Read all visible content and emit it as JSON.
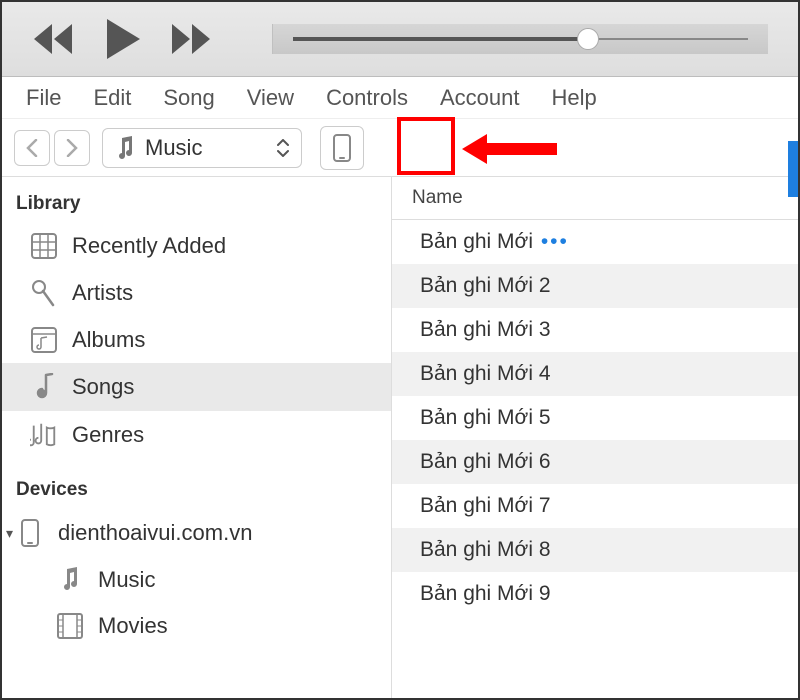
{
  "menubar": [
    "File",
    "Edit",
    "Song",
    "View",
    "Controls",
    "Account",
    "Help"
  ],
  "toolbar": {
    "source_label": "Music"
  },
  "library": {
    "title": "Library",
    "items": [
      {
        "label": "Recently Added",
        "icon": "grid"
      },
      {
        "label": "Artists",
        "icon": "mic"
      },
      {
        "label": "Albums",
        "icon": "album"
      },
      {
        "label": "Songs",
        "icon": "note",
        "selected": true
      },
      {
        "label": "Genres",
        "icon": "genres"
      }
    ]
  },
  "devices": {
    "title": "Devices",
    "device_name": "dienthoaivui.com.vn",
    "subs": [
      {
        "label": "Music",
        "icon": "note"
      },
      {
        "label": "Movies",
        "icon": "film"
      }
    ]
  },
  "content": {
    "column": "Name",
    "rows": [
      {
        "label": "Bản ghi Mới",
        "dots": true
      },
      {
        "label": "Bản ghi Mới 2"
      },
      {
        "label": "Bản ghi Mới 3"
      },
      {
        "label": "Bản ghi Mới 4"
      },
      {
        "label": "Bản ghi Mới 5"
      },
      {
        "label": "Bản ghi Mới 6"
      },
      {
        "label": "Bản ghi Mới 7"
      },
      {
        "label": "Bản ghi Mới 8"
      },
      {
        "label": "Bản ghi Mới 9"
      }
    ]
  }
}
